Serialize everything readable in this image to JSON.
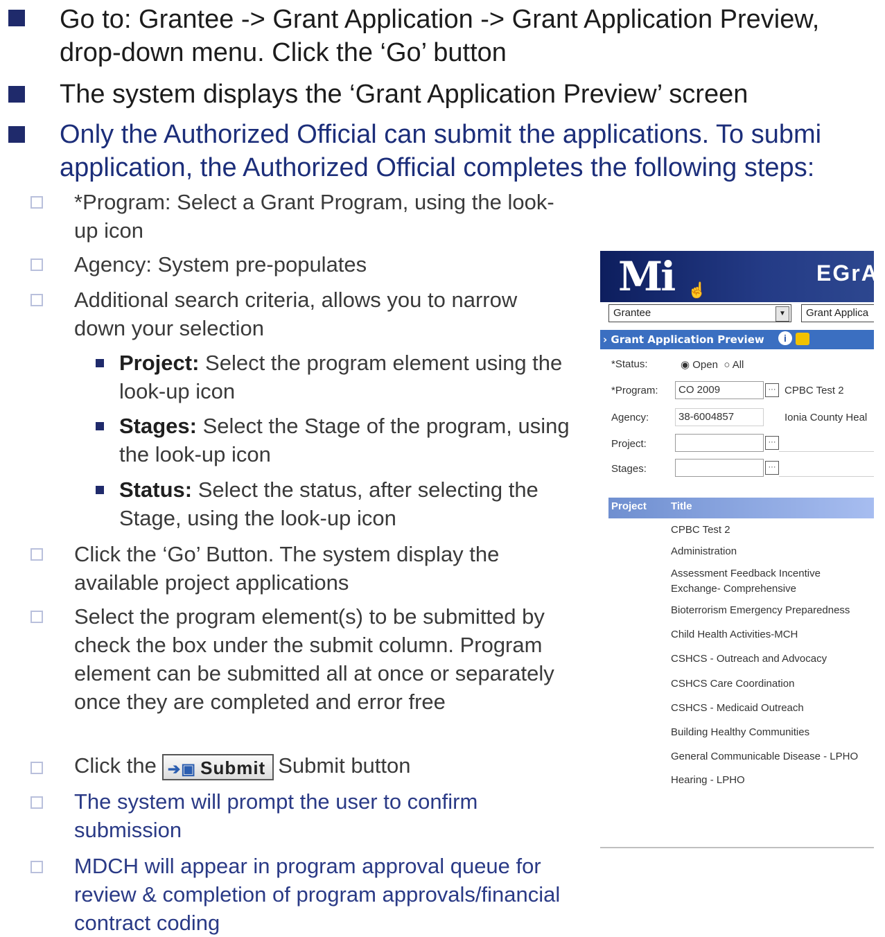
{
  "bullets": [
    {
      "line1": "Go to:  Grantee -> Grant Application -> Grant Application Preview,",
      "line2": "drop-down menu.  Click the ‘Go’ button"
    },
    {
      "line1": "The system displays the ‘Grant Application Preview’ screen"
    },
    {
      "line1": "Only the Authorized Official can submit the applications.  To submi",
      "line2": "application, the Authorized Official completes the following steps:"
    }
  ],
  "steps": [
    "*Program: Select a Grant Program, using the look-up icon",
    "Agency: System pre-populates",
    "Additional search criteria, allows you to narrow down your selection",
    "Click the ‘Go’ Button.  The system display the available project applications",
    "Select the program element(s) to be submitted by check the box under the submit column.  Program element can be submitted all at once or separately once they are completed and error free",
    "The system will prompt the user to confirm submission",
    "MDCH will appear in program approval queue for review & completion of program approvals/financial contract coding"
  ],
  "submit_step": {
    "before": "Click the",
    "button_label": "Submit",
    "after": "Submit button"
  },
  "criteria": [
    {
      "term": "Project:",
      "text": " Select the program element using the look-up icon"
    },
    {
      "term": "Stages:",
      "text": " Select the Stage of the program, using the look-up icon"
    },
    {
      "term": "Status:",
      "text": " Select the status, after selecting the Stage, using the look-up icon"
    }
  ],
  "screenshot": {
    "logo": "Mi",
    "app_title": "EGrA",
    "dropdown_left": "Grantee",
    "dropdown_right": "Grant Applica",
    "breadcrumb": "Grant Application Preview",
    "info_icon": "i",
    "status_label": "*Status:",
    "status_open": "Open",
    "status_all": "All",
    "program_label": "*Program:",
    "program_value": "CO 2009",
    "program_name": "CPBC Test 2",
    "agency_label": "Agency:",
    "agency_value": "38-6004857",
    "agency_name": "Ionia County Heal",
    "project_label": "Project:",
    "stages_label": "Stages:",
    "lookup": "···",
    "table_headers": [
      "Project",
      "Title"
    ],
    "rows": [
      "CPBC Test 2",
      "Administration",
      "Assessment Feedback Incentive Exchange- Comprehensive",
      "Bioterrorism Emergency Preparedness",
      "Child Health Activities-MCH",
      "CSHCS - Outreach and Advocacy",
      "CSHCS Care Coordination",
      "CSHCS - Medicaid Outreach",
      "Building Healthy Communities",
      "General Communicable Disease - LPHO",
      "Hearing - LPHO"
    ]
  },
  "colors": {
    "bullet": "#1f2a6b",
    "header": "#0d1e5e",
    "bar": "#3b6fc1"
  }
}
